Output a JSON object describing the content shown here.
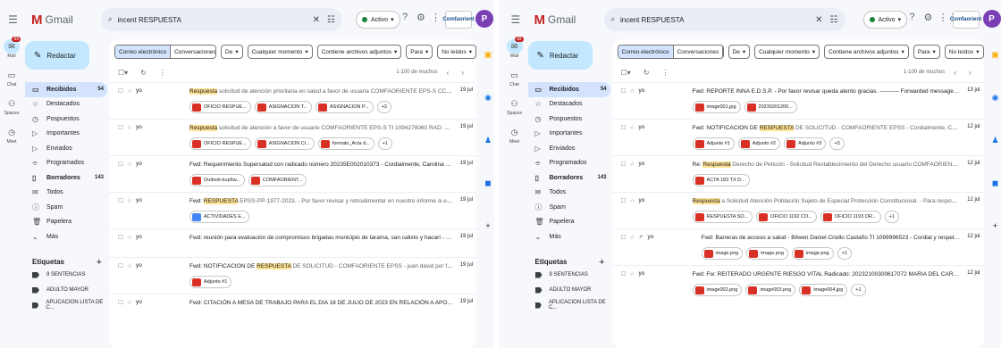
{
  "app": {
    "name": "Gmail",
    "menu_icon": "hamburger-icon"
  },
  "colors": {
    "accent": "#c2e7ff",
    "highlight": "#fde293",
    "active_nav": "#d3e3fd",
    "pdf": "#d93025",
    "avatar": "#7b3fb5",
    "status_green": "#188038"
  },
  "rail": [
    {
      "label": "Mail",
      "badge": "99"
    },
    {
      "label": "Chat"
    },
    {
      "label": "Spaces"
    },
    {
      "label": "Meet"
    }
  ],
  "left": {
    "search": {
      "value": "incent RESPUESTA"
    },
    "status": "Activo",
    "brand": "Comfaorient",
    "avatar": "P",
    "compose": "Redactar",
    "nav": [
      {
        "label": "Recibidos",
        "count": "54"
      },
      {
        "label": "Destacados"
      },
      {
        "label": "Pospuestos"
      },
      {
        "label": "Importantes"
      },
      {
        "label": "Enviados"
      },
      {
        "label": "Programados"
      },
      {
        "label": "Borradores",
        "count": "143"
      },
      {
        "label": "Todos"
      },
      {
        "label": "Spam"
      },
      {
        "label": "Papelera"
      },
      {
        "label": "Más"
      }
    ],
    "labels_title": "Etiquetas",
    "labels": [
      "9 SENTENCIAS",
      "ADULTO MAYOR",
      "APLICACION LISTA DE C..."
    ],
    "chips": {
      "seg": [
        "Correo electrónico",
        "Conversaciones",
        "Espacios"
      ],
      "filters": [
        "De",
        "Cualquier momento",
        "Contiene archivos adjuntos",
        "Para",
        "No leídos"
      ]
    },
    "pagination": "1-100 de muchos",
    "rows": [
      {
        "from": "yo",
        "pre": "",
        "hl": "Respuesta",
        "post": " solicitud de atención prioritaria en salud a favor de usuaria COMFAORIENTE EPS-S CC 1034877571 - P...",
        "date": "19 jul",
        "atts": [
          "OFICIO RESPUE...",
          "ASIGNACION T...",
          "ASIGNACION P..."
        ],
        "more": "+3"
      },
      {
        "from": "yo",
        "pre": "",
        "hl": "Respuesta",
        "post": " solicitud de atención a favor de usuario COMFAORIENTE EPS-S TI 1094278060 RAD: 003840 - Para r...",
        "date": "19 jul",
        "atts": [
          "OFICIO RESPUE...",
          "ASIGNACION CI...",
          "formato_Acta d..."
        ],
        "more": "+1"
      },
      {
        "from": "yo",
        "pre": "Fwd: Requerimiento Supersalud con radicado número 20235E002010373 - Cordialmente, Carolina Rodriguez Tas...",
        "hl": "",
        "post": "",
        "date": "19 jul",
        "atts": [
          "Outlook-kup5w...",
          "COMFAORIENT..."
        ],
        "more": ""
      },
      {
        "from": "yo",
        "pre": "Fwd: ",
        "hl": "RESPUESTA",
        "post": " EPSS-PP-1977-2023. - Por favor revisar y retroalimentar en nuestro informe si es necesario o ojo ...",
        "date": "19 jul",
        "atts": [
          "ACTIVIDADES E..."
        ],
        "more": "",
        "doc": true
      },
      {
        "from": "yo",
        "pre": "Fwd: reunión para evaluación de compromisos brigadas municipio de tarama, san calixto y hacarí - Cordial y resp...",
        "hl": "",
        "post": "",
        "date": "19 jul",
        "atts": [],
        "more": ""
      },
      {
        "from": "yo",
        "pre": "Fwd: NOTIFICACION DE ",
        "hl": "RESPUESTA",
        "post": " DE SOLICITUD - COMFAORIENTE EPSS - juan david por favor adjuntar esto a ...",
        "date": "19 jul",
        "atts": [
          "Adjunto #1"
        ],
        "more": ""
      },
      {
        "from": "yo",
        "pre": "Fwd: CITACIÓN A MESA DE TRABAJO PARA EL DIA 18 DE JULIO DE 2023 EN RELACIÓN A APOYO EN BRIGADAS DE ...",
        "hl": "",
        "post": "",
        "date": "19 jul",
        "atts": [],
        "more": ""
      }
    ]
  },
  "right": {
    "search": {
      "value": "incent RESPUESTA"
    },
    "status": "Activo",
    "brand": "Comfaorient",
    "avatar": "P",
    "compose": "Redactar",
    "nav": [
      {
        "label": "Recibidos",
        "count": "54"
      },
      {
        "label": "Destacados"
      },
      {
        "label": "Pospuestos"
      },
      {
        "label": "Importantes"
      },
      {
        "label": "Enviados"
      },
      {
        "label": "Programados"
      },
      {
        "label": "Borradores",
        "count": "143"
      },
      {
        "label": "Todos"
      },
      {
        "label": "Spam"
      },
      {
        "label": "Papelera"
      },
      {
        "label": "Más"
      }
    ],
    "labels_title": "Etiquetas",
    "labels": [
      "9 SENTENCIAS",
      "ADULTO MAYOR",
      "APLICACION LISTA DE C..."
    ],
    "chips": {
      "seg": [
        "Correo electrónico",
        "Conversaciones",
        "Espacios"
      ],
      "filters": [
        "De",
        "Cualquier momento",
        "Contiene archivos adjuntos",
        "Para",
        "No leídos"
      ]
    },
    "pagination": "1-100 de muchos",
    "rows": [
      {
        "from": "yo",
        "pre": "Fwd: REPORTE INNA E.D.S.P. - Por favor revisar queda atento gracias. ---------- Forwarded message --------- De...",
        "hl": "",
        "post": "",
        "date": "13 jul",
        "atts": [
          "image001.jpg",
          "20230201200..."
        ],
        "more": ""
      },
      {
        "from": "yo",
        "pre": "Fwd: NOTIFICACION DE ",
        "hl": "RESPUESTA",
        "post": " DE SOLICITUD - COMFAORIENTE EPSS - Cordialmente, Carolina Rodriguez Ta...",
        "date": "12 jul",
        "atts": [
          "Adjunto #1",
          "Adjunto #2",
          "Adjunto #3"
        ],
        "more": "+3"
      },
      {
        "from": "yo",
        "pre": "Re: ",
        "hl": "Respuesta",
        "post": " Derecho de Petición - Solicitud Restablecimiento del Derecho usuario COMFAORIENTE_RC 109101...",
        "date": "12 jul",
        "atts": [
          "ACTA 183 TX D..."
        ],
        "more": ""
      },
      {
        "from": "yo",
        "pre": "",
        "hl": "Respuesta",
        "post": " a Solicitud Atención Población Sujeto de Especial Protección Constitucional. - Para responder este do...",
        "date": "12 jul",
        "atts": [
          "RESPUESTA SO...",
          "OFICIO 1192 CO...",
          "OFICIO 1193 OR..."
        ],
        "more": "+1"
      },
      {
        "from": "yo",
        "pre": "Fwd: Barreras de acceso a salud - Bilwen Daniel Criollo Castaño TI 1099996523 - Cordial y respetuoso saludo, Por ...",
        "hl": "",
        "post": "",
        "date": "12 jul",
        "atts": [
          "image.png",
          "image.png",
          "image.png"
        ],
        "more": "+1",
        "reply": true
      },
      {
        "from": "yo",
        "pre": "Fwd: Fw: REITERADO URGENTE RIESGO VITAL Radicado: 20232100300617072 MARIA DEL CARMEN SANCHEZ Z...",
        "hl": "",
        "post": "",
        "date": "12 jul",
        "atts": [
          "image002.png",
          "image003.png",
          "image004.jpg"
        ],
        "more": "+1"
      }
    ]
  }
}
